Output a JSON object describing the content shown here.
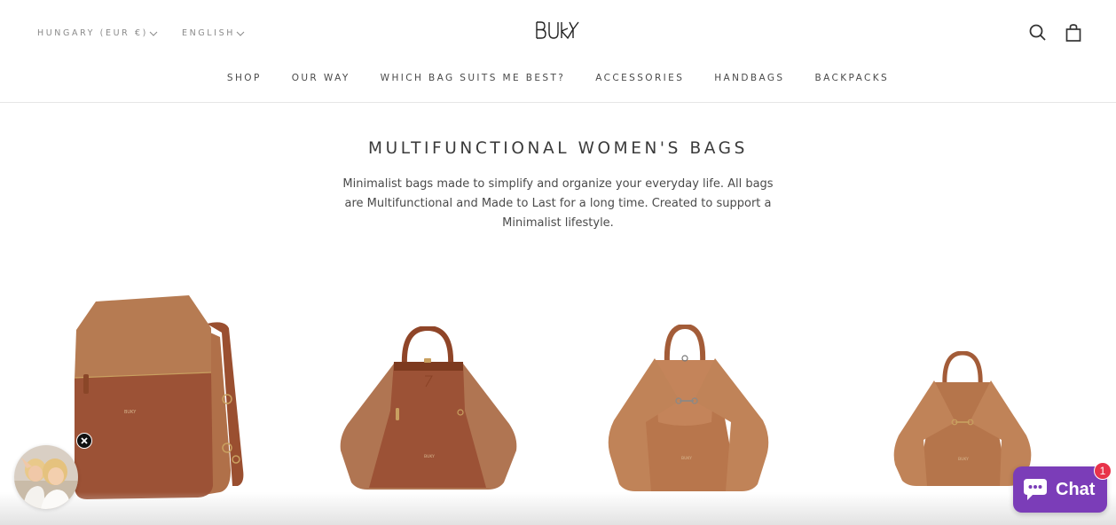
{
  "header": {
    "country_selector": "HUNGARY (EUR €)",
    "language_selector": "ENGLISH",
    "logo_text": "BUKY",
    "icons": {
      "search": "search-icon",
      "cart": "shopping-bag-icon"
    }
  },
  "nav": {
    "items": [
      {
        "label": "SHOP"
      },
      {
        "label": "OUR WAY"
      },
      {
        "label": "WHICH BAG SUITS ME BEST?"
      },
      {
        "label": "ACCESSORIES"
      },
      {
        "label": "HANDBAGS"
      },
      {
        "label": "BACKPACKS"
      }
    ]
  },
  "intro": {
    "title": "MULTIFUNCTIONAL WOMEN'S BAGS",
    "description": "Minimalist bags made to simplify and organize your everyday life. All bags are Multifunctional and Made to Last for a long time. Created to support a Minimalist lifestyle."
  },
  "products": [
    {
      "name": "backpack-hexagon-flap",
      "imprint": "BUKY"
    },
    {
      "name": "leather-suede-tote",
      "imprint": "BUKY"
    },
    {
      "name": "suede-triangle-bag",
      "imprint": "BUKY"
    },
    {
      "name": "suede-triangle-bag-small",
      "imprint": "BUKY"
    }
  ],
  "colors": {
    "accent_chat": "#7b3db8",
    "badge": "#e8334a",
    "leather": "#9c5236",
    "suede": "#b5774e"
  },
  "widgets": {
    "promo_popup": {
      "icon": "close-icon"
    },
    "chat": {
      "label": "Chat",
      "badge_count": "1"
    }
  }
}
